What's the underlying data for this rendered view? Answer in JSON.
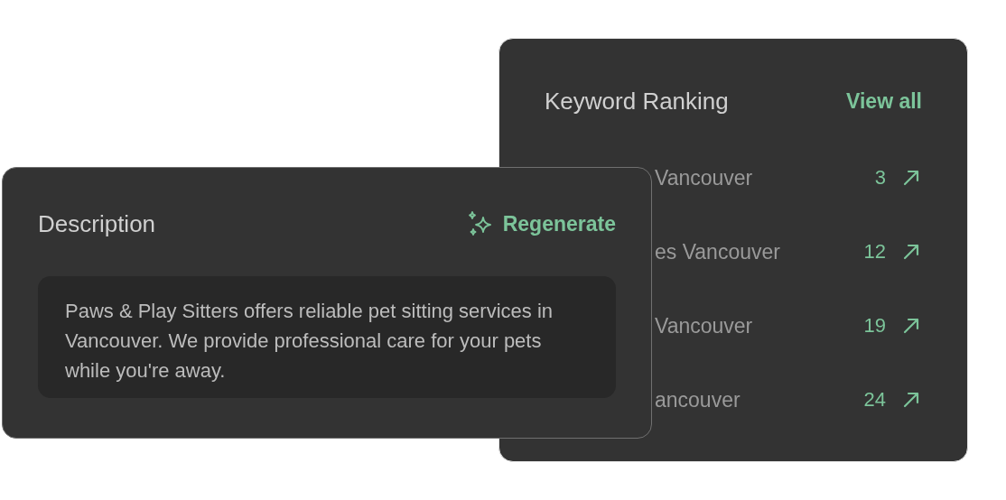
{
  "keyword_ranking": {
    "title": "Keyword Ranking",
    "view_all": "View all",
    "rows": [
      {
        "keyword": "Vancouver",
        "rank": "3"
      },
      {
        "keyword": "es Vancouver",
        "rank": "12"
      },
      {
        "keyword": "Vancouver",
        "rank": "19"
      },
      {
        "keyword": "ancouver",
        "rank": "24"
      }
    ]
  },
  "description": {
    "title": "Description",
    "action": "Regenerate",
    "text": "Paws & Play Sitters offers reliable pet sitting services in Vancouver. We provide professional care for your pets while you're away."
  }
}
